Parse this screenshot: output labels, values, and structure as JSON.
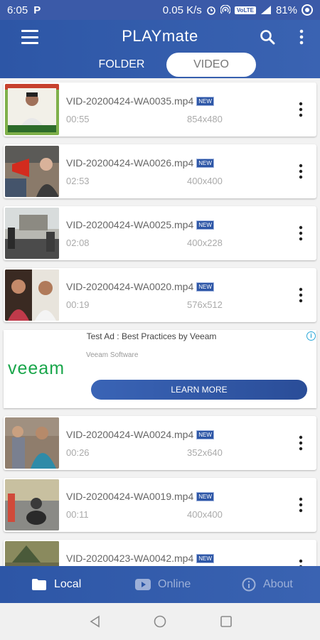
{
  "status_bar": {
    "time": "6:05",
    "app_icon": "P",
    "speed": "0.05 K/s",
    "volte": "VoLTE",
    "battery": "81%"
  },
  "header": {
    "title": "PLAYmate",
    "tabs": [
      {
        "label": "FOLDER",
        "active": false
      },
      {
        "label": "VIDEO",
        "active": true
      }
    ]
  },
  "videos": [
    {
      "name": "VID-20200424-WA0035.mp4",
      "badge": "NEW",
      "duration": "00:55",
      "resolution": "854x480"
    },
    {
      "name": "VID-20200424-WA0026.mp4",
      "badge": "NEW",
      "duration": "02:53",
      "resolution": "400x400"
    },
    {
      "name": "VID-20200424-WA0025.mp4",
      "badge": "NEW",
      "duration": "02:08",
      "resolution": "400x228"
    },
    {
      "name": "VID-20200424-WA0020.mp4",
      "badge": "NEW",
      "duration": "00:19",
      "resolution": "576x512"
    }
  ],
  "ad": {
    "title": "Test Ad : Best Practices by Veeam",
    "advertiser": "Veeam Software",
    "logo_text": "veeam",
    "cta": "LEARN MORE",
    "info": "i"
  },
  "videos_after_ad": [
    {
      "name": "VID-20200424-WA0024.mp4",
      "badge": "NEW",
      "duration": "00:26",
      "resolution": "352x640"
    },
    {
      "name": "VID-20200424-WA0019.mp4",
      "badge": "NEW",
      "duration": "00:11",
      "resolution": "400x400"
    },
    {
      "name": "VID-20200423-WA0042.mp4",
      "badge": "NEW",
      "duration": "",
      "resolution": ""
    }
  ],
  "bottom_nav": [
    {
      "label": "Local",
      "icon": "folder-icon",
      "active": true
    },
    {
      "label": "Online",
      "icon": "youtube-icon",
      "active": false
    },
    {
      "label": "About",
      "icon": "info-icon",
      "active": false
    }
  ],
  "colors": {
    "primary": "#2d56a6",
    "ad_logo": "#1aa64b",
    "inactive_nav": "#9db0d8"
  }
}
